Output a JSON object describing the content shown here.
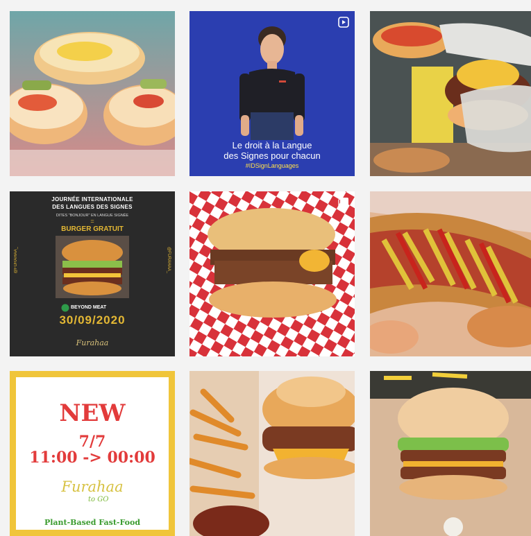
{
  "feed": {
    "posts": [
      {
        "type": "photo",
        "icon": "burgers-tray-photo"
      },
      {
        "type": "video",
        "icon": "reel-icon",
        "caption_line1": "Le droit à la Langue",
        "caption_line2": "des Signes pour chacun",
        "hashtag": "#IDSignLanguages"
      },
      {
        "type": "photo",
        "icon": "gloved-hands-burger-photo"
      },
      {
        "type": "poster",
        "title_line1": "JOURNÉE INTERNATIONALE",
        "title_line2": "DES LANGUES DES SIGNES",
        "subtitle": "DITES \"BONJOUR\" EN LANGUE SIGNÉE",
        "equals": "=",
        "offer": "BURGER GRATUIT",
        "handle": "@FURAHAA_",
        "brand": "BEYOND MEAT",
        "date": "30/09/2020",
        "logo": "Furahaa"
      },
      {
        "type": "carousel",
        "icon": "carousel-icon"
      },
      {
        "type": "photo",
        "icon": "hotdog-photo"
      },
      {
        "type": "promo",
        "headline": "NEW",
        "days": "7/7",
        "hours": "11:00 -> 00:00",
        "logo": "Furahaa",
        "logo_sub": "to GO",
        "tagline": "Plant-Based Fast-Food"
      },
      {
        "type": "photo",
        "icon": "burger-fries-photo"
      },
      {
        "type": "photo",
        "icon": "double-burger-photo"
      }
    ]
  },
  "colors": {
    "background": "#f3f3f3",
    "sign_bg": "#2b3eb0",
    "poster_bg": "#2a2a2a",
    "poster_gold": "#e4b834",
    "promo_red": "#e23b3b",
    "promo_green": "#3a9b2e",
    "promo_border": "#f0c53a"
  }
}
